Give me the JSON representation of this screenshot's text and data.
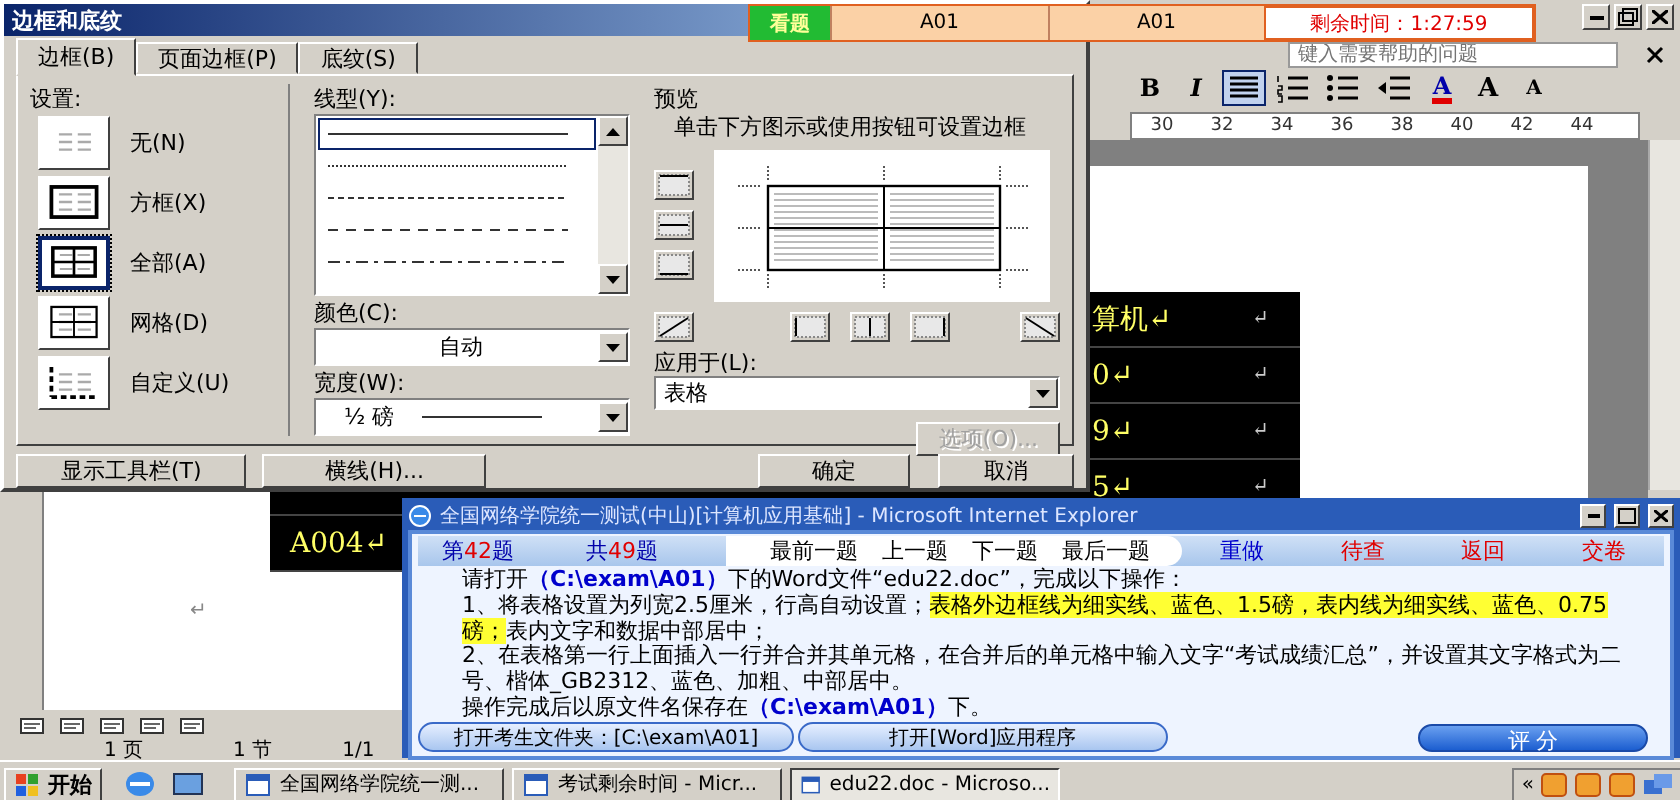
{
  "timer_bar": {
    "tab": "看题",
    "fields": [
      "A01",
      "A01"
    ],
    "remaining": "剩余时间：1:27:59"
  },
  "word": {
    "help_placeholder": "键入需要帮助的问题",
    "toolbar": [
      {
        "kind": "bold",
        "label": "B",
        "pressed": false
      },
      {
        "kind": "italic",
        "label": "I",
        "pressed": false
      },
      {
        "kind": "align",
        "pressed": true
      },
      {
        "kind": "numbered",
        "pressed": false
      },
      {
        "kind": "bullets",
        "pressed": false
      },
      {
        "kind": "indent",
        "pressed": false
      },
      {
        "kind": "font-color",
        "label": "A",
        "pressed": false
      },
      {
        "kind": "grow",
        "label": "A",
        "pressed": false
      },
      {
        "kind": "shrink",
        "label": "A",
        "pressed": false
      }
    ],
    "ruler": [
      "30",
      "32",
      "34",
      "36",
      "38",
      "40",
      "42",
      "44"
    ],
    "table": [
      {
        "kind": "right",
        "cells": [
          "算机↵",
          "↵"
        ]
      },
      {
        "kind": "right",
        "cells": [
          "0↵",
          "↵"
        ]
      },
      {
        "kind": "right",
        "cells": [
          "9↵",
          "↵"
        ]
      },
      {
        "kind": "right",
        "cells": [
          "5↵",
          "↵"
        ]
      },
      {
        "kind": "left",
        "cells": [
          "A004↵"
        ]
      }
    ],
    "paragraph_mark": "↵",
    "status": [
      "1 页",
      "1 节",
      "1/1"
    ]
  },
  "dialog": {
    "title": "边框和底纹",
    "tabs": [
      {
        "label": "边框(B)",
        "selected": true
      },
      {
        "label": "页面边框(P)",
        "selected": false
      },
      {
        "label": "底纹(S)",
        "selected": false
      }
    ],
    "settings_label": "设置:",
    "settings": [
      {
        "kind": "none",
        "label": "无(N)",
        "selected": false
      },
      {
        "kind": "box",
        "label": "方框(X)",
        "selected": false
      },
      {
        "kind": "all",
        "label": "全部(A)",
        "selected": true
      },
      {
        "kind": "grid",
        "label": "网格(D)",
        "selected": false
      },
      {
        "kind": "custom",
        "label": "自定义(U)",
        "selected": false
      }
    ],
    "line_style_label": "线型(Y):",
    "line_styles": [
      {
        "kind": "solid",
        "selected": true
      },
      {
        "kind": "dotted",
        "selected": false
      },
      {
        "kind": "dashed",
        "selected": false
      },
      {
        "kind": "dash-long",
        "selected": false
      },
      {
        "kind": "dash-dot",
        "selected": false
      }
    ],
    "color_label": "颜色(C):",
    "color_value": "自动",
    "width_label": "宽度(W):",
    "width_value": "½ 磅",
    "preview_label": "预览",
    "preview_hint": "单击下方图示或使用按钮可设置边框",
    "apply_label": "应用于(L):",
    "apply_value": "表格",
    "options_button": {
      "label": "选项(O)...",
      "disabled": true
    },
    "buttons": [
      "显示工具栏(T)",
      "横线(H)...",
      "确定",
      "取消"
    ]
  },
  "ie": {
    "title": "全国网络学院统一测试(中山)[计算机应用基础] - Microsoft Internet Explorer",
    "counters": [
      {
        "prefix": "第",
        "number": "42",
        "suffix": "题"
      },
      {
        "prefix": "共",
        "number": "49",
        "suffix": "题"
      }
    ],
    "nav": [
      "最前一题",
      "上一题",
      "下一题",
      "最后一题"
    ],
    "actions": [
      {
        "label": "重做",
        "color": "#0000cc"
      },
      {
        "label": "待查",
        "color": "#e00000"
      },
      {
        "label": "返回",
        "color": "#e00000"
      },
      {
        "label": "交卷",
        "color": "#e00000"
      }
    ],
    "paragraphs": [
      [
        {
          "kind": "plain",
          "text": "请打开"
        },
        {
          "kind": "path",
          "text": "（C:\\exam\\A01）"
        },
        {
          "kind": "plain",
          "text": "下的Word文件“edu22.doc”，完成以下操作："
        }
      ],
      [
        {
          "kind": "plain",
          "text": "1、将表格设置为列宽2.5厘米，行高自动设置；"
        },
        {
          "kind": "highlight",
          "text": "表格外边框线为细实线、蓝色、1.5磅，表内线为细实线、蓝色、0.75磅；"
        },
        {
          "kind": "plain",
          "text": "表内文字和数据中部居中；"
        }
      ],
      [
        {
          "kind": "plain",
          "text": "2、在表格第一行上面插入一行并合并其单元格，在合并后的单元格中输入文字“考试成绩汇总”，并设置其文字格式为二号、楷体_GB2312、蓝色、加粗、中部居中。"
        }
      ],
      [
        {
          "kind": "plain",
          "text": "操作完成后以原文件名保存在"
        },
        {
          "kind": "path",
          "text": "（C:\\exam\\A01）"
        },
        {
          "kind": "plain",
          "text": "下。"
        }
      ]
    ],
    "buttons": [
      "打开考生文件夹：[C:\\exam\\A01]",
      "打开[Word]应用程序"
    ],
    "grade_button": "评 分"
  },
  "taskbar": {
    "start": "开始",
    "tasks": [
      {
        "label": "全国网络学院统一测...",
        "selected": false
      },
      {
        "label": "考试剩余时间 - Micr...",
        "selected": false
      },
      {
        "label": "edu22.doc - Microso...",
        "selected": true
      }
    ],
    "tray": "«"
  }
}
